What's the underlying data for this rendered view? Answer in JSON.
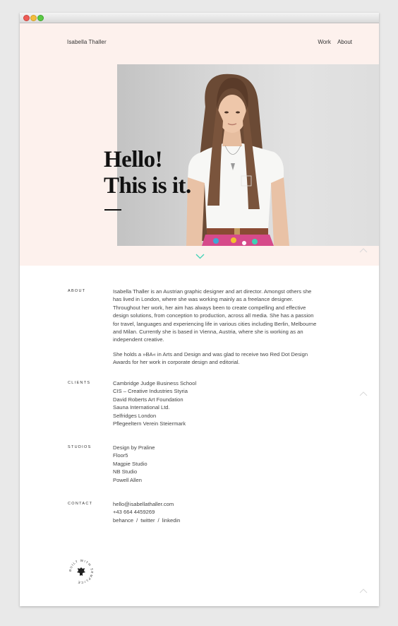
{
  "site": {
    "name": "Isabella Thaller"
  },
  "nav": {
    "items": [
      "Work",
      "About"
    ]
  },
  "hero": {
    "headline": [
      "Hello!",
      "This is it."
    ]
  },
  "sections": {
    "about": {
      "label": "About",
      "paragraphs": [
        "Isabella Thaller is an Austrian graphic designer and art director. Amongst others she has lived in London, where she was working mainly as a freelance designer. Throughout her work, her aim has always been to create compelling and effective design solutions, from conception to production, across all media. She has a passion for travel, languages and experiencing life in various cities including Berlin, Melbourne and Milan. Currently she is based in Vienna, Austria, where she is working as an independent creative.",
        "She holds a »BA« in Arts and Design and was glad to receive two Red Dot Design Awards for her work in corporate design and editorial."
      ]
    },
    "clients": {
      "label": "Clients",
      "items": [
        "Cambridge Judge Business School",
        "CIS – Creative Industries Styria",
        "David Roberts Art Foundation",
        "Sauna International Ltd.",
        "Selfridges London",
        "Pflegeeltern Verein Steiermark"
      ]
    },
    "studios": {
      "label": "Studios",
      "items": [
        "Design by Praline",
        "Floor5",
        "Magpie Studio",
        "NB Studio",
        "Powell Allen"
      ]
    },
    "contact": {
      "label": "Contact",
      "email": "hello@isabellathaller.com",
      "phone": "+43 664 4459269",
      "social": [
        "behance",
        "twitter",
        "linkedin"
      ],
      "separator": "/"
    }
  },
  "badge": {
    "text": "BUILT WITH SEMPLICE"
  },
  "colors": {
    "hero_bg": "#fdf1ed",
    "accent": "#3fd2b6",
    "arrow_muted": "#d8d8d8"
  }
}
